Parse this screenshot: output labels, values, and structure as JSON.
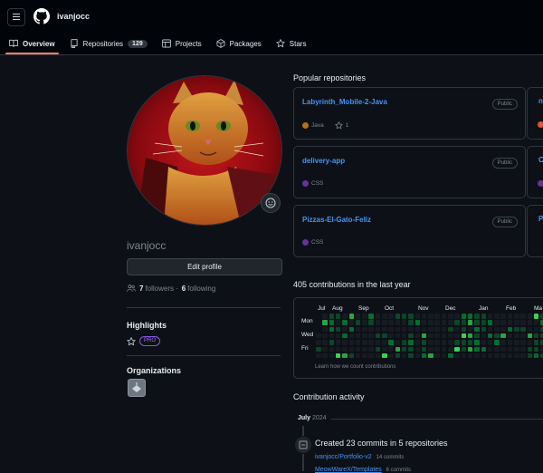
{
  "header": {
    "username": "ivanjocc",
    "tabs": [
      {
        "label": "Overview",
        "icon": "book-icon",
        "active": true
      },
      {
        "label": "Repositories",
        "icon": "repo-icon",
        "count": "129"
      },
      {
        "label": "Projects",
        "icon": "table-icon"
      },
      {
        "label": "Packages",
        "icon": "package-icon"
      },
      {
        "label": "Stars",
        "icon": "star-icon"
      }
    ]
  },
  "profile": {
    "login": "ivanjocc",
    "edit_label": "Edit profile",
    "followers": "7",
    "followers_label": "followers",
    "separator": "·",
    "following": "6",
    "following_label": "following",
    "highlights_title": "Highlights",
    "pro_badge": "PRO",
    "organizations_title": "Organizations"
  },
  "popular": {
    "title": "Popular repositories",
    "repos": [
      {
        "name": "Labyrinth_Mobile-2-Java",
        "visibility": "Public",
        "language": "Java",
        "lang_color": "#b07219",
        "stars": "1"
      },
      {
        "name": "delivery-app",
        "visibility": "Public",
        "language": "CSS",
        "lang_color": "#663399"
      },
      {
        "name": "Pizzas-El-Gato-Feliz",
        "visibility": "Public",
        "language": "CSS",
        "lang_color": "#663399"
      }
    ],
    "stubs": [
      "n",
      "C",
      "P"
    ]
  },
  "contributions": {
    "title": "405 contributions in the last year",
    "months": [
      "Jul",
      "Aug",
      "Sep",
      "Oct",
      "Nov",
      "Dec",
      "Jan",
      "Feb",
      "Ma"
    ],
    "days": [
      "Mon",
      "Wed",
      "Fri"
    ],
    "learn": "Learn how we count contributions",
    "colors": [
      "#161b22",
      "#0e4429",
      "#006d32",
      "#26a641",
      "#39d353"
    ]
  },
  "activity": {
    "title": "Contribution activity",
    "month": "July",
    "year": "2024",
    "summary": "Created 23 commits in 5 repositories",
    "commits": [
      {
        "repo": "ivanjocc/Portfolio-v2",
        "count": "14 commits"
      },
      {
        "repo": "MeowWareX/Templates",
        "count": "6 commits"
      }
    ]
  }
}
